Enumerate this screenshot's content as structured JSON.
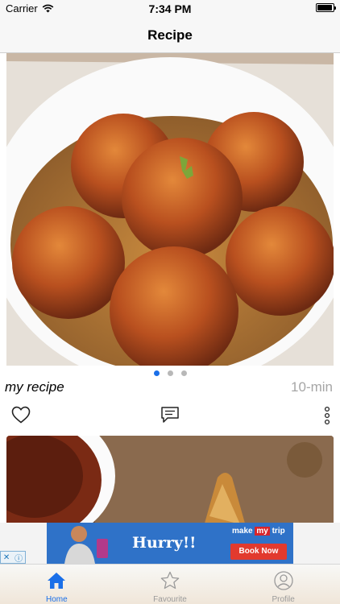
{
  "status_bar": {
    "carrier": "Carrier",
    "time": "7:34 PM",
    "battery_level": 0.95
  },
  "nav": {
    "title": "Recipe"
  },
  "feed": {
    "cards": [
      {
        "image": "gulab-jamun-photo",
        "title": "my recipe",
        "duration": "10-min",
        "pager": {
          "pages": 3,
          "active": 1
        },
        "actions": [
          "heart-icon",
          "comment-icon",
          "more-vertical-icon"
        ]
      },
      {
        "image": "samosa-photo"
      }
    ]
  },
  "ad": {
    "headline": "Hurry!!",
    "brand_prefix": "make",
    "brand_mark": "my",
    "brand_suffix": "trip",
    "cta": "Book Now"
  },
  "tab_bar": {
    "items": [
      {
        "label": "Home",
        "icon": "home-icon",
        "active": true
      },
      {
        "label": "Favourite",
        "icon": "star-icon",
        "active": false
      },
      {
        "label": "Profile",
        "icon": "profile-icon",
        "active": false
      }
    ]
  },
  "colors": {
    "accent": "#1a6fe8",
    "muted_text": "#a6a6a6"
  }
}
